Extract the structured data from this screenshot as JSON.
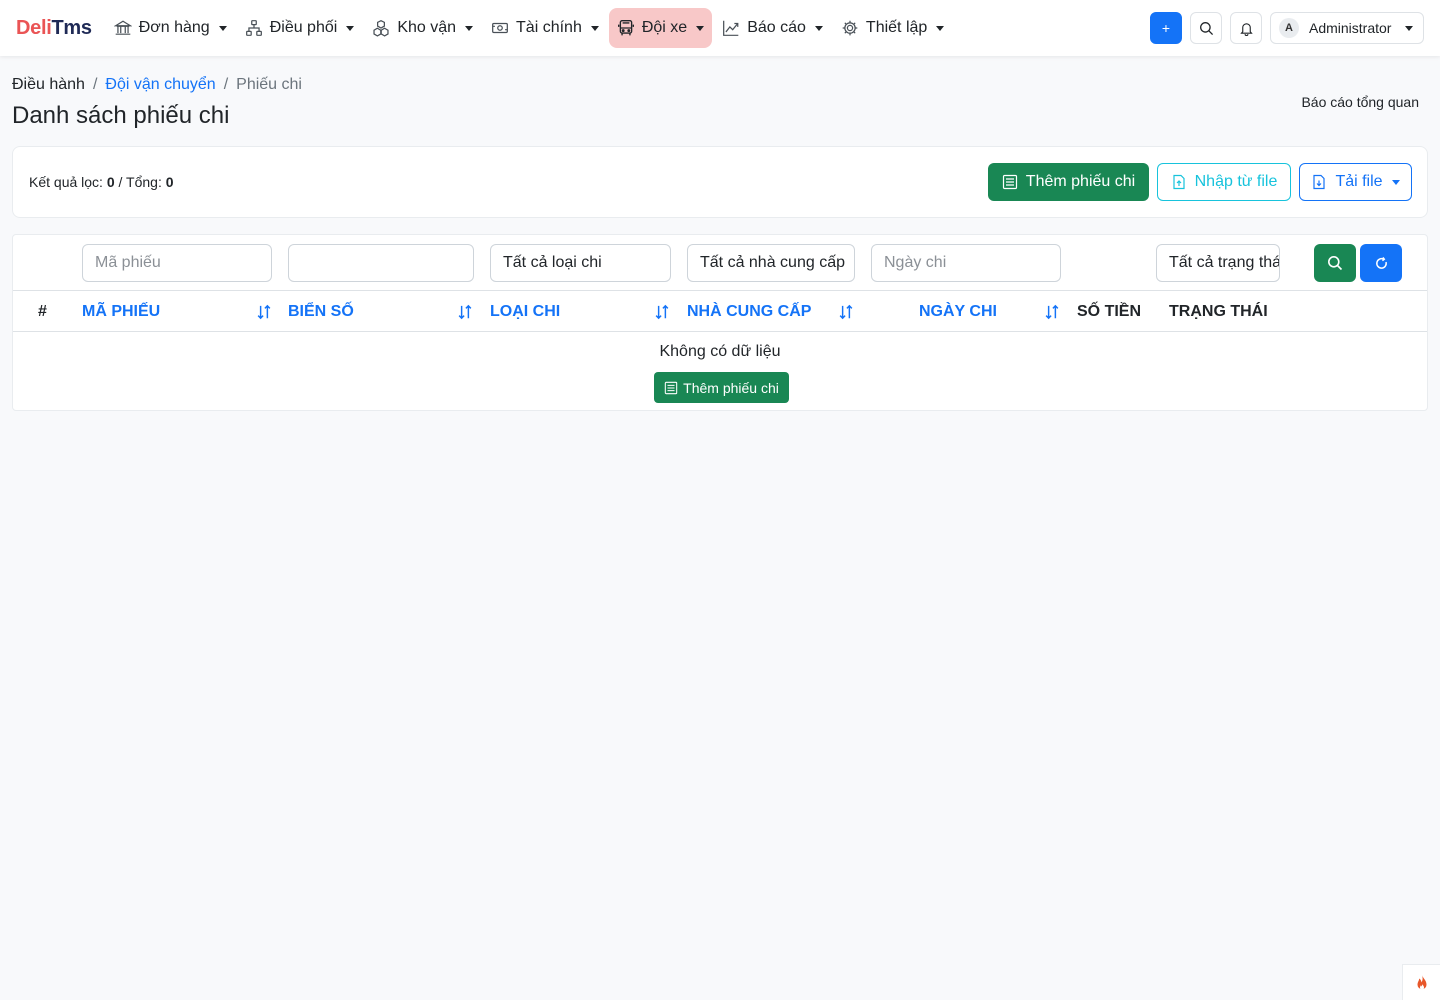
{
  "brand": {
    "part1": "Deli",
    "part2": "Tms"
  },
  "nav": {
    "items": [
      {
        "label": "Đơn hàng",
        "icon": "bank-icon"
      },
      {
        "label": "Điều phối",
        "icon": "diagram-icon"
      },
      {
        "label": "Kho vận",
        "icon": "boxes-icon"
      },
      {
        "label": "Tài chính",
        "icon": "cash-icon"
      },
      {
        "label": "Đội xe",
        "icon": "bus-icon",
        "active": true
      },
      {
        "label": "Báo cáo",
        "icon": "graph-up-icon"
      },
      {
        "label": "Thiết lập",
        "icon": "gear-icon"
      }
    ],
    "quick_add": "+",
    "user": {
      "initial": "A",
      "name": "Administrator"
    }
  },
  "breadcrumb": {
    "root": "Điều hành",
    "parent": "Đội vận chuyển",
    "current": "Phiếu chi"
  },
  "page": {
    "title": "Danh sách phiếu chi",
    "report_link": "Báo cáo tổng quan"
  },
  "summary": {
    "filtered_label": "Kết quả lọc:",
    "filtered_count": "0",
    "separator": " / ",
    "total_label": "Tổng:",
    "total_count": "0"
  },
  "actions": {
    "add": "Thêm phiếu chi",
    "import": "Nhập từ file",
    "download": "Tải file"
  },
  "filters": {
    "code_placeholder": "Mã phiếu",
    "plate_value": "",
    "type_selected": "Tất cả loại chi",
    "supplier_selected": "Tất cả nhà cung cấp",
    "date_placeholder": "Ngày chi",
    "status_selected": "Tất cả trạng thái"
  },
  "table": {
    "columns": [
      "#",
      "Mã phiếu",
      "Biển số",
      "Loại chi",
      "Nhà cung cấp",
      "Ngày chi",
      "Số tiền",
      "Trạng thái"
    ],
    "empty_text": "Không có dữ liệu",
    "empty_add": "Thêm phiếu chi"
  },
  "colors": {
    "primary": "#1473f7",
    "success": "#198754",
    "info": "#17c3dc",
    "danger_brand": "#ea5455",
    "nav_active_bg": "#f8c8c8"
  }
}
